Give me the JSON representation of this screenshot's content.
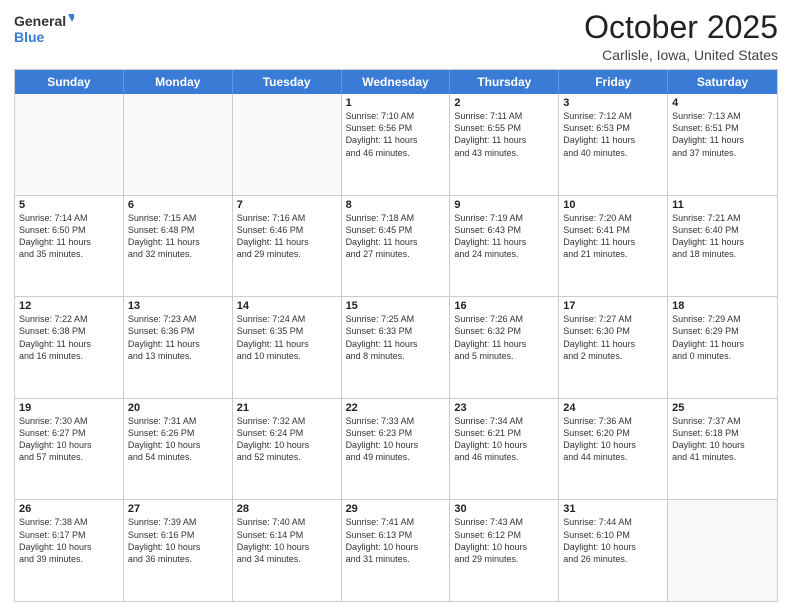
{
  "logo": {
    "line1": "General",
    "line2": "Blue"
  },
  "title": "October 2025",
  "location": "Carlisle, Iowa, United States",
  "weekdays": [
    "Sunday",
    "Monday",
    "Tuesday",
    "Wednesday",
    "Thursday",
    "Friday",
    "Saturday"
  ],
  "weeks": [
    [
      {
        "day": "",
        "info": ""
      },
      {
        "day": "",
        "info": ""
      },
      {
        "day": "",
        "info": ""
      },
      {
        "day": "1",
        "info": "Sunrise: 7:10 AM\nSunset: 6:56 PM\nDaylight: 11 hours\nand 46 minutes."
      },
      {
        "day": "2",
        "info": "Sunrise: 7:11 AM\nSunset: 6:55 PM\nDaylight: 11 hours\nand 43 minutes."
      },
      {
        "day": "3",
        "info": "Sunrise: 7:12 AM\nSunset: 6:53 PM\nDaylight: 11 hours\nand 40 minutes."
      },
      {
        "day": "4",
        "info": "Sunrise: 7:13 AM\nSunset: 6:51 PM\nDaylight: 11 hours\nand 37 minutes."
      }
    ],
    [
      {
        "day": "5",
        "info": "Sunrise: 7:14 AM\nSunset: 6:50 PM\nDaylight: 11 hours\nand 35 minutes."
      },
      {
        "day": "6",
        "info": "Sunrise: 7:15 AM\nSunset: 6:48 PM\nDaylight: 11 hours\nand 32 minutes."
      },
      {
        "day": "7",
        "info": "Sunrise: 7:16 AM\nSunset: 6:46 PM\nDaylight: 11 hours\nand 29 minutes."
      },
      {
        "day": "8",
        "info": "Sunrise: 7:18 AM\nSunset: 6:45 PM\nDaylight: 11 hours\nand 27 minutes."
      },
      {
        "day": "9",
        "info": "Sunrise: 7:19 AM\nSunset: 6:43 PM\nDaylight: 11 hours\nand 24 minutes."
      },
      {
        "day": "10",
        "info": "Sunrise: 7:20 AM\nSunset: 6:41 PM\nDaylight: 11 hours\nand 21 minutes."
      },
      {
        "day": "11",
        "info": "Sunrise: 7:21 AM\nSunset: 6:40 PM\nDaylight: 11 hours\nand 18 minutes."
      }
    ],
    [
      {
        "day": "12",
        "info": "Sunrise: 7:22 AM\nSunset: 6:38 PM\nDaylight: 11 hours\nand 16 minutes."
      },
      {
        "day": "13",
        "info": "Sunrise: 7:23 AM\nSunset: 6:36 PM\nDaylight: 11 hours\nand 13 minutes."
      },
      {
        "day": "14",
        "info": "Sunrise: 7:24 AM\nSunset: 6:35 PM\nDaylight: 11 hours\nand 10 minutes."
      },
      {
        "day": "15",
        "info": "Sunrise: 7:25 AM\nSunset: 6:33 PM\nDaylight: 11 hours\nand 8 minutes."
      },
      {
        "day": "16",
        "info": "Sunrise: 7:26 AM\nSunset: 6:32 PM\nDaylight: 11 hours\nand 5 minutes."
      },
      {
        "day": "17",
        "info": "Sunrise: 7:27 AM\nSunset: 6:30 PM\nDaylight: 11 hours\nand 2 minutes."
      },
      {
        "day": "18",
        "info": "Sunrise: 7:29 AM\nSunset: 6:29 PM\nDaylight: 11 hours\nand 0 minutes."
      }
    ],
    [
      {
        "day": "19",
        "info": "Sunrise: 7:30 AM\nSunset: 6:27 PM\nDaylight: 10 hours\nand 57 minutes."
      },
      {
        "day": "20",
        "info": "Sunrise: 7:31 AM\nSunset: 6:26 PM\nDaylight: 10 hours\nand 54 minutes."
      },
      {
        "day": "21",
        "info": "Sunrise: 7:32 AM\nSunset: 6:24 PM\nDaylight: 10 hours\nand 52 minutes."
      },
      {
        "day": "22",
        "info": "Sunrise: 7:33 AM\nSunset: 6:23 PM\nDaylight: 10 hours\nand 49 minutes."
      },
      {
        "day": "23",
        "info": "Sunrise: 7:34 AM\nSunset: 6:21 PM\nDaylight: 10 hours\nand 46 minutes."
      },
      {
        "day": "24",
        "info": "Sunrise: 7:36 AM\nSunset: 6:20 PM\nDaylight: 10 hours\nand 44 minutes."
      },
      {
        "day": "25",
        "info": "Sunrise: 7:37 AM\nSunset: 6:18 PM\nDaylight: 10 hours\nand 41 minutes."
      }
    ],
    [
      {
        "day": "26",
        "info": "Sunrise: 7:38 AM\nSunset: 6:17 PM\nDaylight: 10 hours\nand 39 minutes."
      },
      {
        "day": "27",
        "info": "Sunrise: 7:39 AM\nSunset: 6:16 PM\nDaylight: 10 hours\nand 36 minutes."
      },
      {
        "day": "28",
        "info": "Sunrise: 7:40 AM\nSunset: 6:14 PM\nDaylight: 10 hours\nand 34 minutes."
      },
      {
        "day": "29",
        "info": "Sunrise: 7:41 AM\nSunset: 6:13 PM\nDaylight: 10 hours\nand 31 minutes."
      },
      {
        "day": "30",
        "info": "Sunrise: 7:43 AM\nSunset: 6:12 PM\nDaylight: 10 hours\nand 29 minutes."
      },
      {
        "day": "31",
        "info": "Sunrise: 7:44 AM\nSunset: 6:10 PM\nDaylight: 10 hours\nand 26 minutes."
      },
      {
        "day": "",
        "info": ""
      }
    ]
  ]
}
